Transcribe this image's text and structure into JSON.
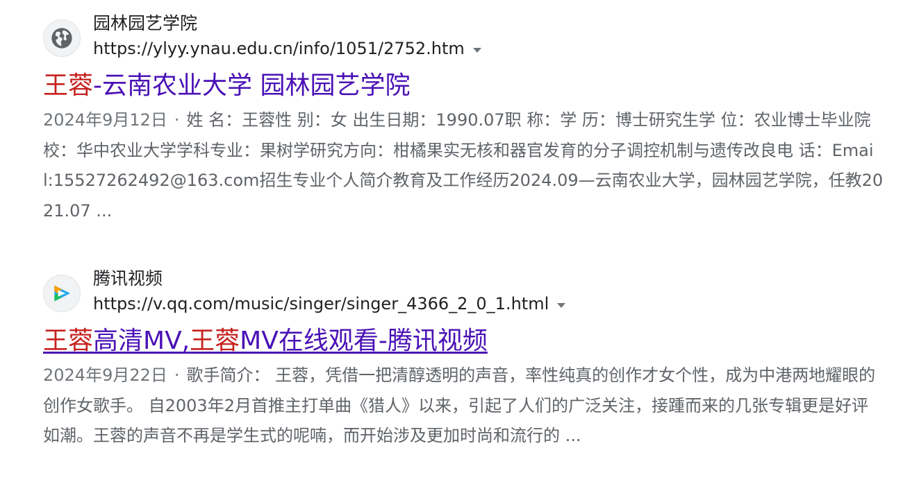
{
  "results": [
    {
      "site_name": "园林园艺学院",
      "url": "https://ylyy.ynau.edu.cn/info/1051/2752.htm",
      "favicon": "globe-icon",
      "title_hl1": "王蓉",
      "title_rest1": "-云南农业大学 园林园艺学院",
      "date": "2024年9月12日",
      "separator": "·",
      "snippet": "姓 名：王蓉性 别：女 出生日期：1990.07职 称：学 历：博士研究生学 位：农业博士毕业院校：华中农业大学学科专业：果树学研究方向：柑橘果实无核和器官发育的分子调控机制与遗传改良电 话：Email:15527262492@163.com招生专业个人简介教育及工作经历2024.09—云南农业大学，园林园艺学院，任教2021.07 ..."
    },
    {
      "site_name": "腾讯视频",
      "url": "https://v.qq.com/music/singer/singer_4366_2_0_1.html",
      "favicon": "tencent-video-icon",
      "title_hl1": "王蓉",
      "title_mid": "高清MV,",
      "title_hl2": "王蓉",
      "title_rest2": "MV在线观看-腾讯视频",
      "date": "2024年9月22日",
      "separator": "·",
      "snippet": "歌手简介： 王蓉，凭借一把清醇透明的声音，率性纯真的创作才女个性，成为中港两地耀眼的创作女歌手。 自2003年2月首推主打单曲《猎人》以来，引起了人们的广泛关注，接踵而来的几张专辑更是好评如潮。王蓉的声音不再是学生式的呢喃，而开始涉及更加时尚和流行的 ..."
    }
  ],
  "colors": {
    "title": "#4a11b5",
    "highlight": "#c5221f",
    "snippet": "#5f6368",
    "site": "#202124"
  }
}
